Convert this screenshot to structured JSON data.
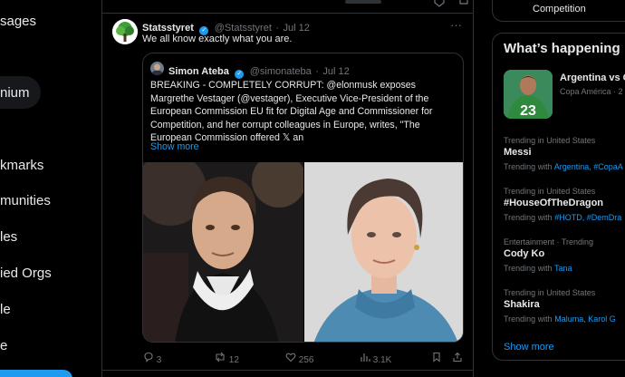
{
  "nav": {
    "items": [
      "sages",
      "nium",
      "kmarks",
      "munities",
      "les",
      "ied Orgs",
      "le",
      "e"
    ]
  },
  "tweet": {
    "author_name": "Statsstyret",
    "author_handle": "@Statsstyret",
    "separator": "·",
    "date": "Jul 12",
    "text": "We all know exactly what you are.",
    "more_icon": "more-dots-icon",
    "quote": {
      "author_name": "Simon Ateba",
      "author_handle": "@simonateba",
      "date": "Jul 12",
      "text": "BREAKING - COMPLETELY CORRUPT: @elonmusk exposes Margrethe Vestager (@vestager), Executive Vice-President of the European Commission EU fit for Digital Age and Commissioner for Competition, and her corrupt colleagues in Europe, writes, \"The European Commission offered 𝕏 an",
      "show_more": "Show more"
    },
    "stats": {
      "replies": "3",
      "reposts": "12",
      "likes": "256",
      "views": "3.1K"
    }
  },
  "sidebar": {
    "top_card_text": "Competition",
    "whats_happening": "What’s happening",
    "featured": {
      "title": "Argentina vs C",
      "subtitle": "Copa América · 2",
      "jersey_number": "23"
    },
    "trends": [
      {
        "context": "Trending in United States",
        "name": "Messi",
        "with_label": "Trending with",
        "with": "Argentina, #CopaA"
      },
      {
        "context": "Trending in United States",
        "name": "#HouseOfTheDragon",
        "with_label": "Trending with",
        "with": "#HOTD, #DemDra"
      },
      {
        "context": "Entertainment · Trending",
        "name": "Cody Ko",
        "with_label": "Trending with",
        "with": "Tana"
      },
      {
        "context": "Trending in United States",
        "name": "Shakira",
        "with_label": "Trending with",
        "with": "Maluma, Karol G"
      }
    ],
    "show_more": "Show more"
  },
  "colors": {
    "accent": "#1d9bf0",
    "background": "#000000",
    "border": "#2f3336",
    "muted": "#71767b",
    "text": "#e7e9ea"
  }
}
